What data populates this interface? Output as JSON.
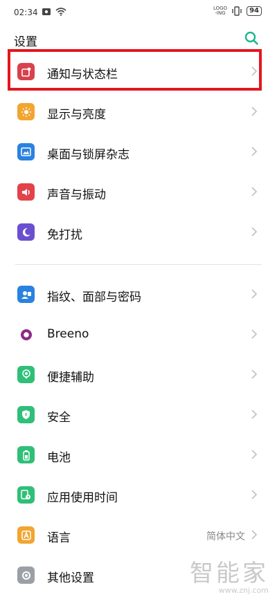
{
  "status_bar": {
    "time": "02:34",
    "logo_ing_top": "LOGO",
    "logo_ing_bottom": "-ING",
    "battery": "94"
  },
  "header": {
    "title": "设置",
    "search_icon": "search-icon",
    "accent": "#1db58e"
  },
  "group1": [
    {
      "label": "通知与状态栏",
      "icon": "notification-icon",
      "color": "#d8424d"
    },
    {
      "label": "显示与亮度",
      "icon": "brightness-icon",
      "color": "#f2a530"
    },
    {
      "label": "桌面与锁屏杂志",
      "icon": "wallpaper-icon",
      "color": "#2a82e0"
    },
    {
      "label": "声音与振动",
      "icon": "sound-icon",
      "color": "#e2434b"
    },
    {
      "label": "免打扰",
      "icon": "moon-icon",
      "color": "#6b4fd1"
    }
  ],
  "group2": [
    {
      "label": "指纹、面部与密码",
      "icon": "fingerprint-icon",
      "color": "#2a82e0",
      "value": ""
    },
    {
      "label": "Breeno",
      "icon": "breeno-icon",
      "color": "#8e2a86",
      "value": ""
    },
    {
      "label": "便捷辅助",
      "icon": "assist-icon",
      "color": "#2fbf78",
      "value": ""
    },
    {
      "label": "安全",
      "icon": "shield-icon",
      "color": "#2fbf78",
      "value": ""
    },
    {
      "label": "电池",
      "icon": "battery-icon",
      "color": "#2fbf78",
      "value": ""
    },
    {
      "label": "应用使用时间",
      "icon": "app-time-icon",
      "color": "#2fbf78",
      "value": ""
    },
    {
      "label": "语言",
      "icon": "language-icon",
      "color": "#f2a530",
      "value": "简体中文"
    },
    {
      "label": "其他设置",
      "icon": "other-settings-icon",
      "color": "#9aa0a6",
      "value": ""
    }
  ],
  "watermark": {
    "main": "智能家",
    "sub": "www.znj.com"
  }
}
